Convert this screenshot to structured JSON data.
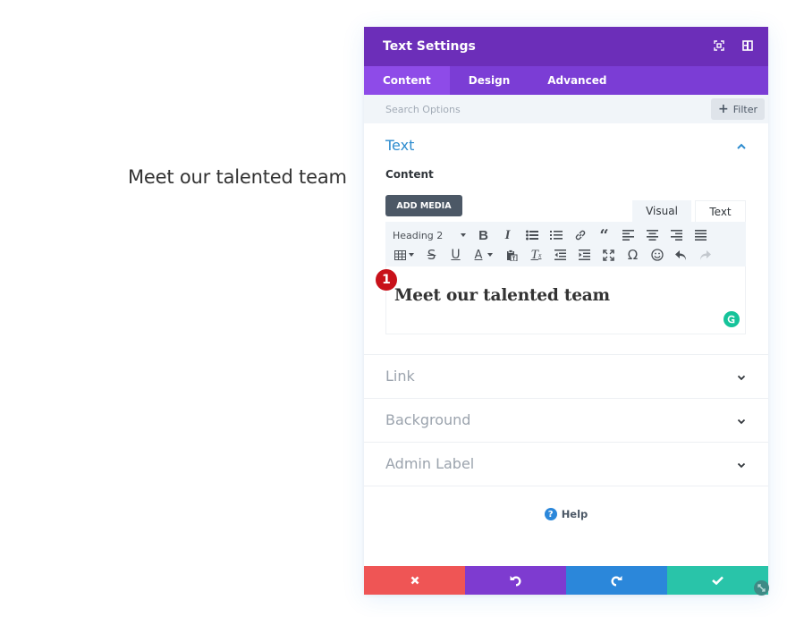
{
  "page": {
    "heading": "Meet our talented team"
  },
  "modal": {
    "title": "Text Settings",
    "header_icons": [
      "focus-icon",
      "split-view-icon"
    ],
    "tabs": [
      {
        "label": "Content",
        "active": true
      },
      {
        "label": "Design",
        "active": false
      },
      {
        "label": "Advanced",
        "active": false
      }
    ],
    "search": {
      "placeholder": "Search Options",
      "value": ""
    },
    "filter_label": "Filter",
    "sections": {
      "text": {
        "title": "Text",
        "expanded": true,
        "content_label": "Content",
        "add_media_label": "ADD MEDIA",
        "editor_tabs": [
          "Visual",
          "Text"
        ],
        "format_select": "Heading 2",
        "editor_content": "Meet our talented team",
        "step_badge": "1"
      },
      "link": {
        "title": "Link",
        "expanded": false
      },
      "background": {
        "title": "Background",
        "expanded": false
      },
      "admin_label": {
        "title": "Admin Label",
        "expanded": false
      }
    },
    "help_label": "Help",
    "footer": {
      "buttons": [
        {
          "name": "cancel",
          "icon": "close-icon",
          "color": "#ef5555"
        },
        {
          "name": "undo",
          "icon": "undo-icon",
          "color": "#7e3bd0"
        },
        {
          "name": "redo",
          "icon": "redo-icon",
          "color": "#2b87da"
        },
        {
          "name": "save",
          "icon": "check-icon",
          "color": "#29c4a9"
        }
      ]
    }
  },
  "colors": {
    "header_bg": "#6c2eb9",
    "tabs_bg": "#7b3dd5",
    "active_tab_bg": "#8e4be8",
    "section_title_active": "#2e8ccf",
    "badge": "#c8111a",
    "grammarly": "#15c39a"
  }
}
